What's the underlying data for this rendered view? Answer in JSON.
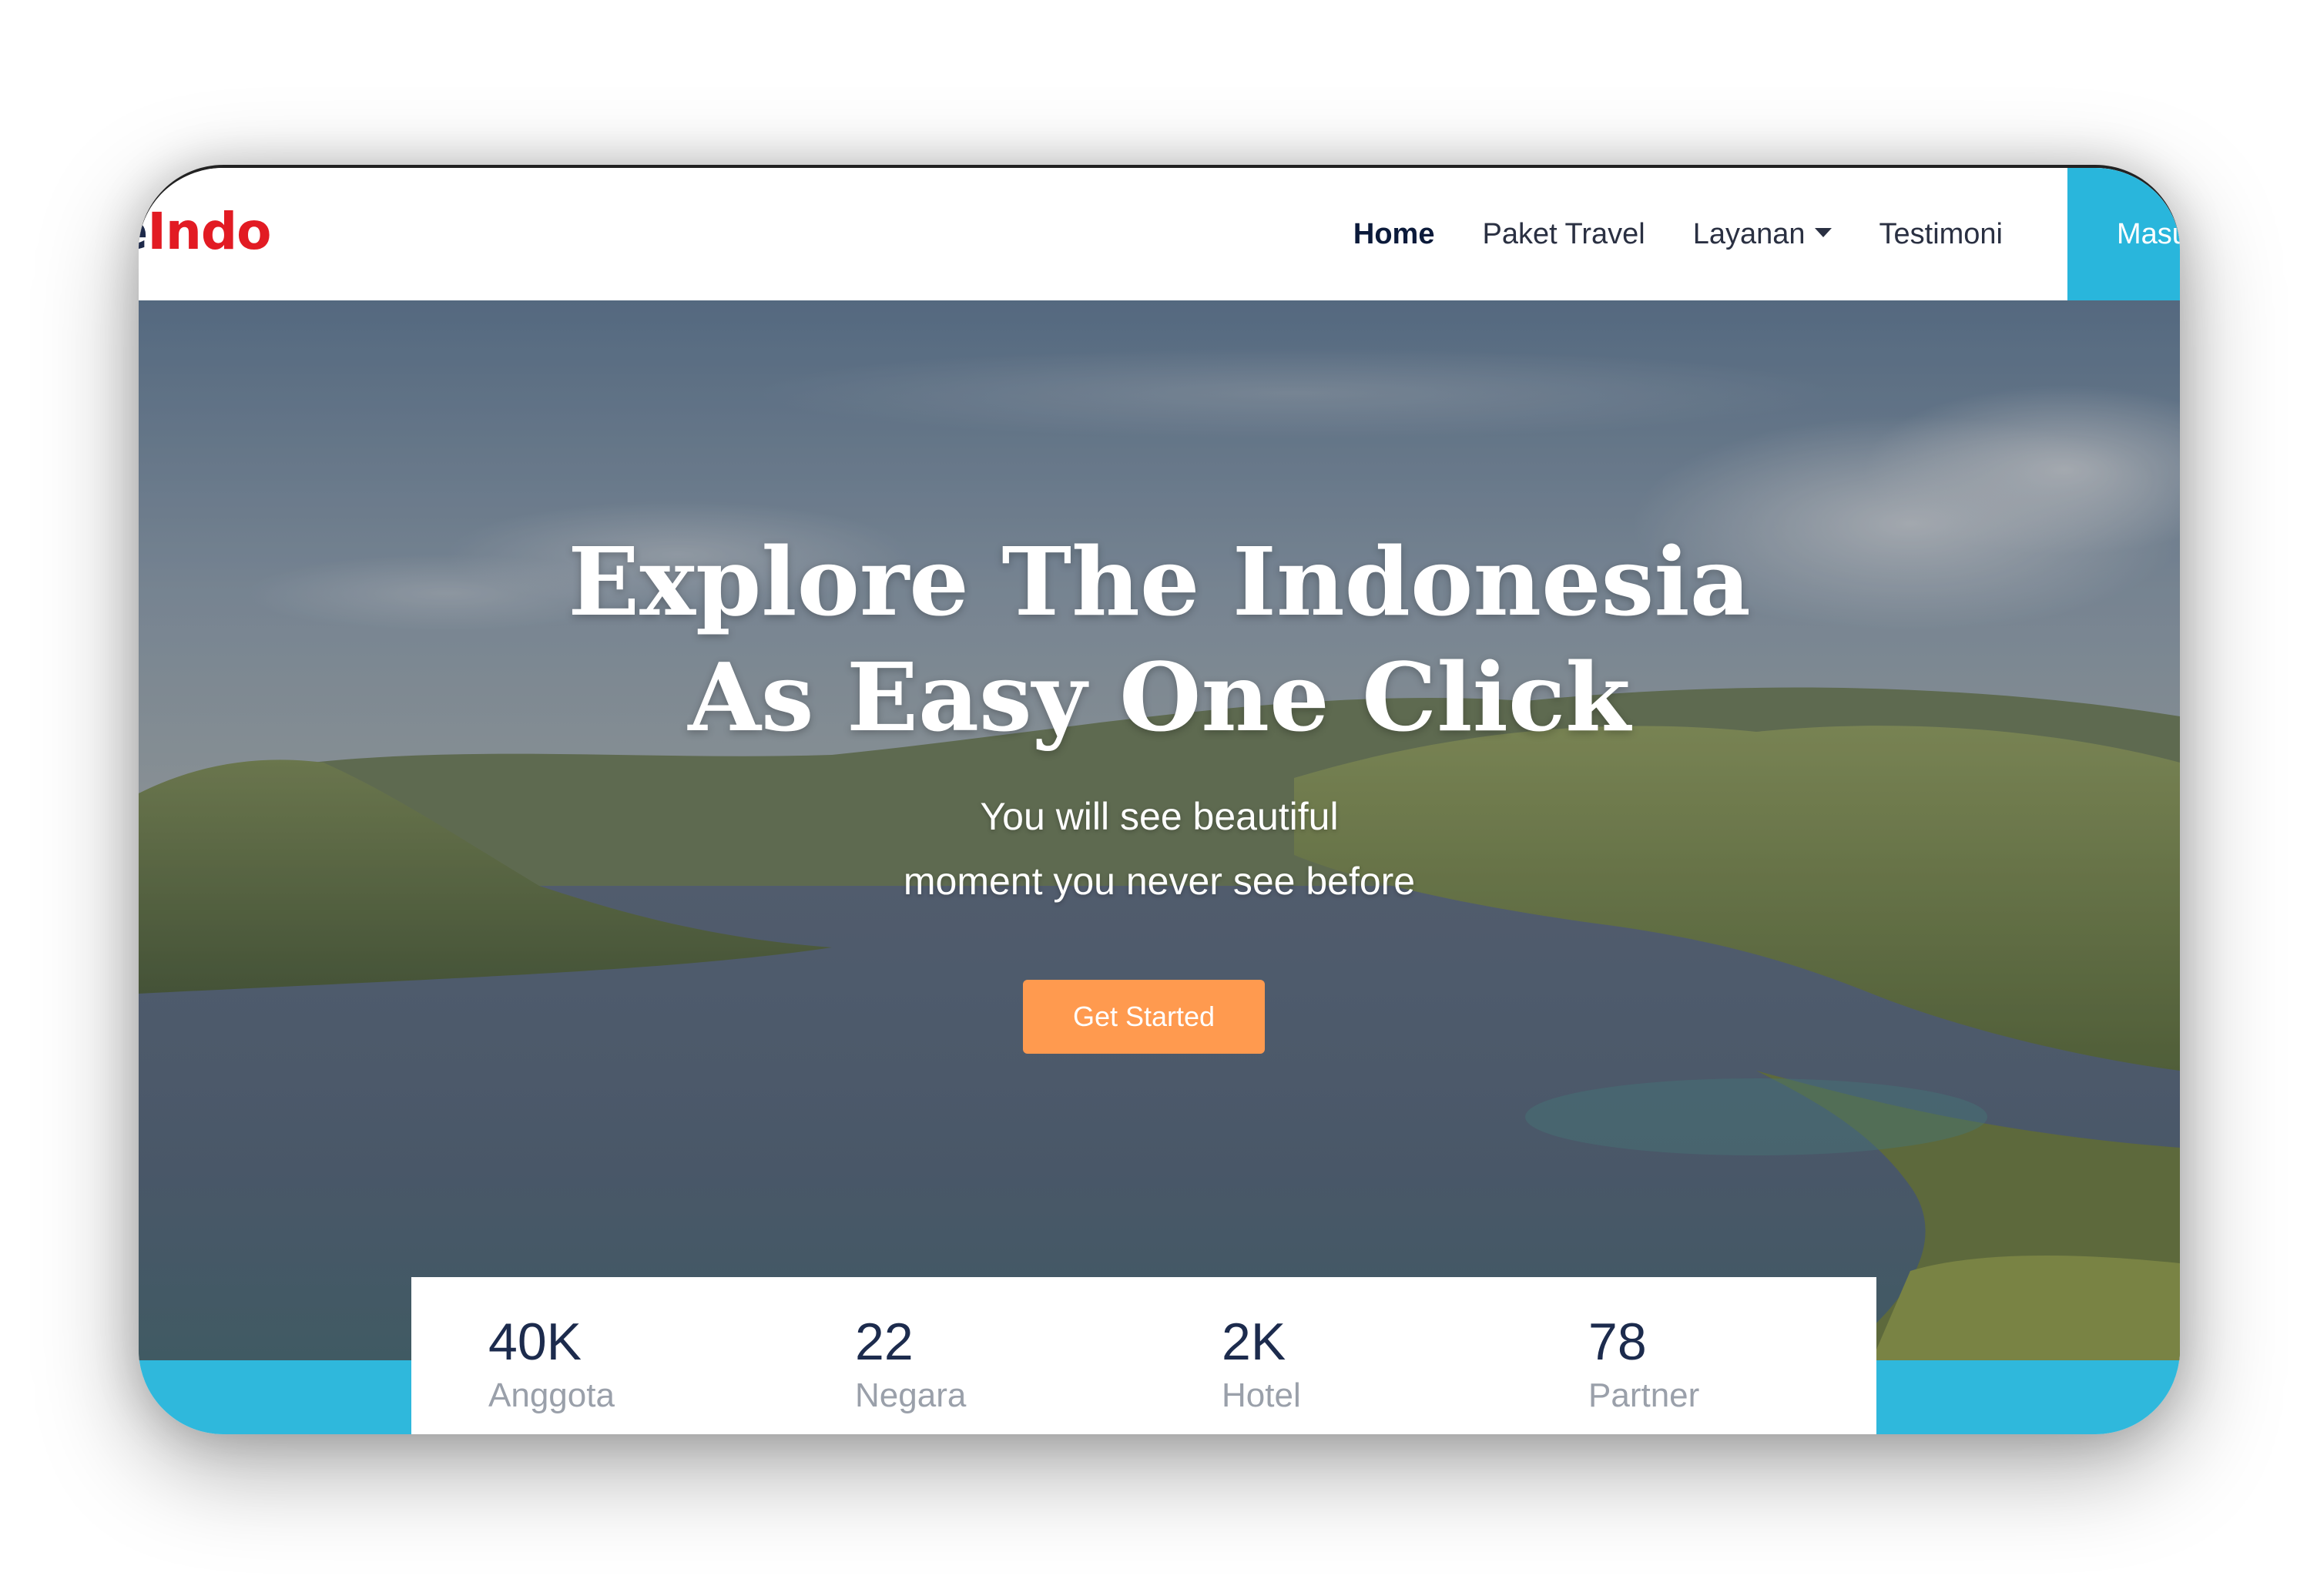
{
  "brand": {
    "part1": "ave",
    "part2": "Indo"
  },
  "nav": {
    "items": [
      {
        "label": "Home",
        "active": true
      },
      {
        "label": "Paket Travel"
      },
      {
        "label": "Layanan",
        "dropdown": true
      },
      {
        "label": "Testimoni"
      }
    ],
    "login_label": "Masuk"
  },
  "hero": {
    "title_line1": "Explore The Indonesia",
    "title_line2": "As Easy One Click",
    "subtitle_line1": "You will see beautiful",
    "subtitle_line2": "moment you never see before",
    "cta_label": "Get Started"
  },
  "stats": [
    {
      "value": "40K",
      "label": "Anggota"
    },
    {
      "value": "22",
      "label": "Negara"
    },
    {
      "value": "2K",
      "label": "Hotel"
    },
    {
      "value": "78",
      "label": "Partner"
    }
  ],
  "colors": {
    "accent_blue": "#29b6dc",
    "cta_orange": "#ff9a4f",
    "brand_red": "#e21b23",
    "brand_navy": "#1e2a4a"
  }
}
